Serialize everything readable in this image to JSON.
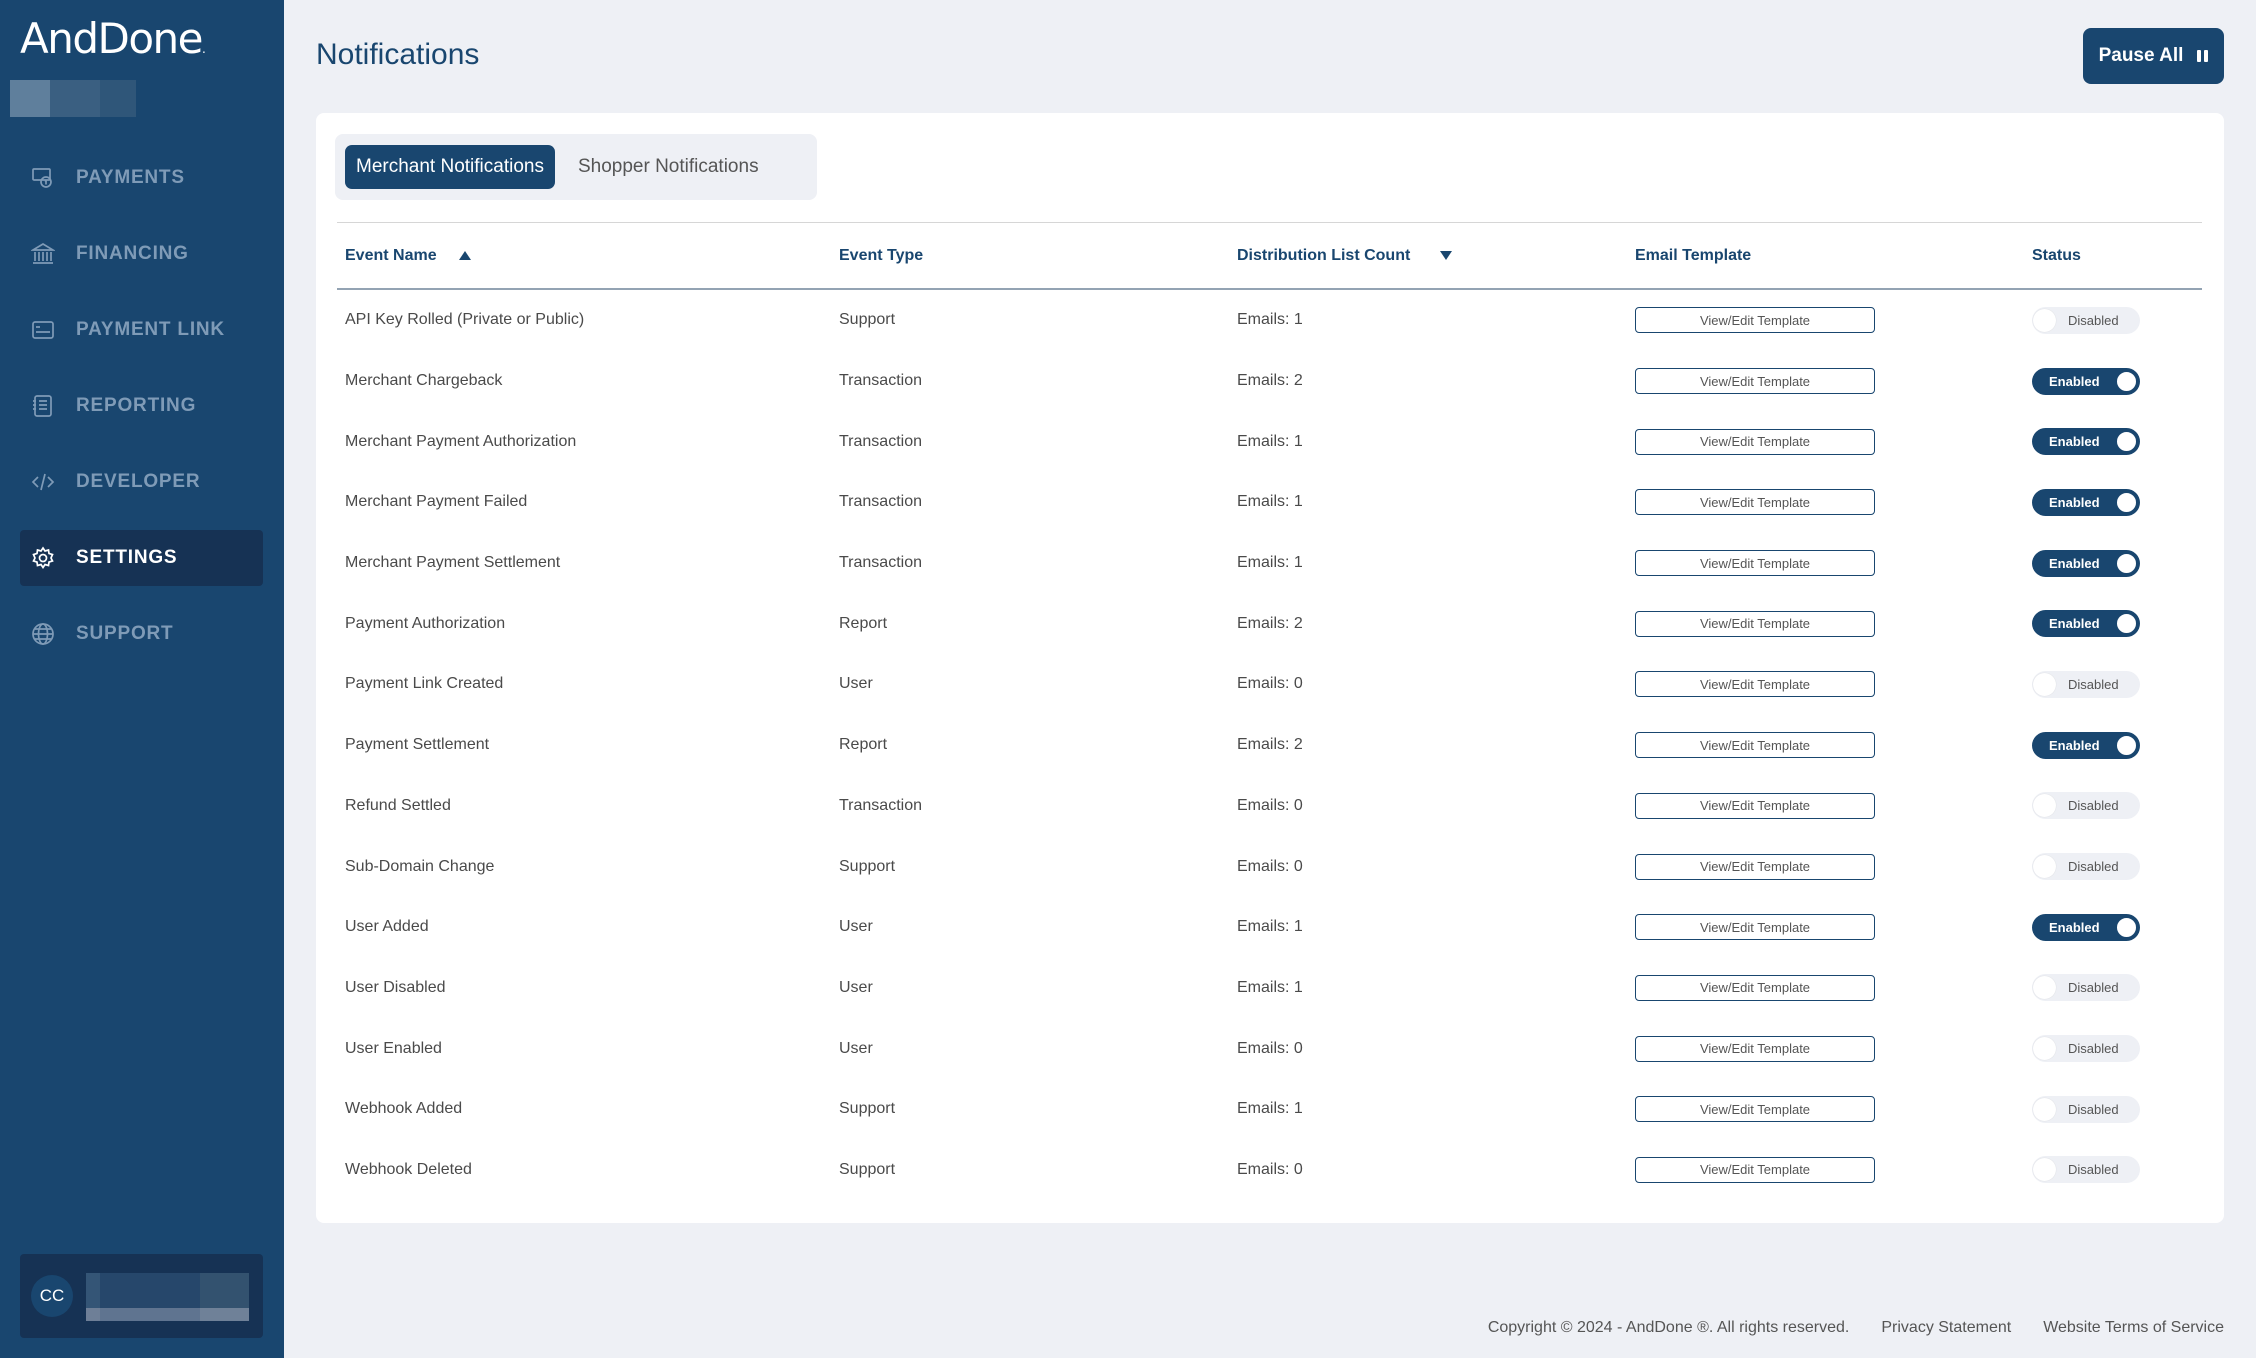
{
  "app": {
    "logo_text": "AndDone",
    "logo_mark": "."
  },
  "sidebar": {
    "items": [
      {
        "label": "PAYMENTS",
        "icon": "payments-icon",
        "active": false
      },
      {
        "label": "FINANCING",
        "icon": "bank-icon",
        "active": false
      },
      {
        "label": "PAYMENT LINK",
        "icon": "payment-link-icon",
        "active": false
      },
      {
        "label": "REPORTING",
        "icon": "reporting-icon",
        "active": false
      },
      {
        "label": "DEVELOPER",
        "icon": "code-icon",
        "active": false
      },
      {
        "label": "SETTINGS",
        "icon": "gear-icon",
        "active": true
      },
      {
        "label": "SUPPORT",
        "icon": "globe-icon",
        "active": false
      }
    ],
    "user": {
      "initials": "CC"
    }
  },
  "header": {
    "title": "Notifications",
    "pause_all_label": "Pause All",
    "pause_icon": "pause-icon"
  },
  "tabs": [
    {
      "label": "Merchant Notifications",
      "active": true
    },
    {
      "label": "Shopper Notifications",
      "active": false
    }
  ],
  "table": {
    "columns": [
      "Event Name",
      "Event Type",
      "Distribution List Count",
      "Email Template",
      "Status"
    ],
    "sort": {
      "event_name": "ascending",
      "distribution_list_count": "descending"
    },
    "template_button_label": "View/Edit Template",
    "status_labels": {
      "on": "Enabled",
      "off": "Disabled"
    },
    "rows": [
      {
        "event_name": "API Key Rolled (Private or Public)",
        "event_type": "Support",
        "count": "Emails: 1",
        "status": "Disabled"
      },
      {
        "event_name": "Merchant Chargeback",
        "event_type": "Transaction",
        "count": "Emails: 2",
        "status": "Enabled"
      },
      {
        "event_name": "Merchant Payment Authorization",
        "event_type": "Transaction",
        "count": "Emails: 1",
        "status": "Enabled"
      },
      {
        "event_name": "Merchant Payment Failed",
        "event_type": "Transaction",
        "count": "Emails: 1",
        "status": "Enabled"
      },
      {
        "event_name": "Merchant Payment Settlement",
        "event_type": "Transaction",
        "count": "Emails: 1",
        "status": "Enabled"
      },
      {
        "event_name": "Payment Authorization",
        "event_type": "Report",
        "count": "Emails: 2",
        "status": "Enabled"
      },
      {
        "event_name": "Payment Link Created",
        "event_type": "User",
        "count": "Emails: 0",
        "status": "Disabled"
      },
      {
        "event_name": "Payment Settlement",
        "event_type": "Report",
        "count": "Emails: 2",
        "status": "Enabled"
      },
      {
        "event_name": "Refund Settled",
        "event_type": "Transaction",
        "count": "Emails: 0",
        "status": "Disabled"
      },
      {
        "event_name": "Sub-Domain Change",
        "event_type": "Support",
        "count": "Emails: 0",
        "status": "Disabled"
      },
      {
        "event_name": "User Added",
        "event_type": "User",
        "count": "Emails: 1",
        "status": "Enabled"
      },
      {
        "event_name": "User Disabled",
        "event_type": "User",
        "count": "Emails: 1",
        "status": "Disabled"
      },
      {
        "event_name": "User Enabled",
        "event_type": "User",
        "count": "Emails: 0",
        "status": "Disabled"
      },
      {
        "event_name": "Webhook Added",
        "event_type": "Support",
        "count": "Emails: 1",
        "status": "Disabled"
      },
      {
        "event_name": "Webhook Deleted",
        "event_type": "Support",
        "count": "Emails: 0",
        "status": "Disabled"
      }
    ]
  },
  "footer": {
    "copyright": "Copyright © 2024 - AndDone ®. All rights reserved.",
    "privacy": "Privacy Statement",
    "terms": "Website Terms of Service"
  },
  "colors": {
    "brand": "#19466f",
    "sidebar_active": "#163254",
    "background": "#eef0f5"
  }
}
